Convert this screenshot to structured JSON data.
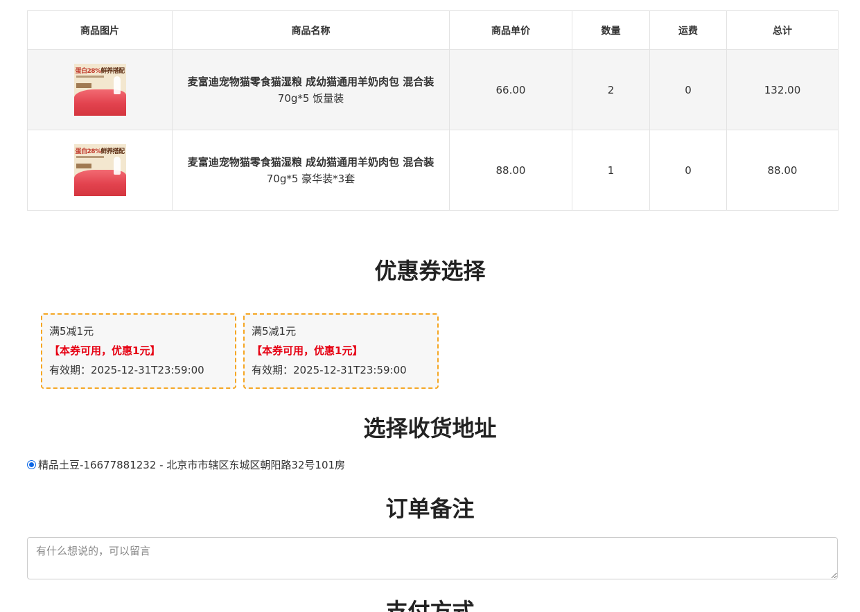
{
  "table": {
    "headers": [
      "商品图片",
      "商品名称",
      "商品单价",
      "数量",
      "运费",
      "总计"
    ],
    "rows": [
      {
        "thumb_text": "蛋白28%",
        "thumb_suffix": "鲜养搭配",
        "name_main": "麦富迪宠物猫零食猫湿粮 成幼猫通用羊奶肉包 混合装",
        "name_spec": "70g*5 饭量装",
        "price": "66.00",
        "qty": "2",
        "shipping": "0",
        "total": "132.00"
      },
      {
        "thumb_text": "蛋白28%",
        "thumb_suffix": "鲜养搭配",
        "name_main": "麦富迪宠物猫零食猫湿粮 成幼猫通用羊奶肉包 混合装",
        "name_spec": "70g*5 豪华装*3套",
        "price": "88.00",
        "qty": "1",
        "shipping": "0",
        "total": "88.00"
      }
    ]
  },
  "coupons": {
    "title": "优惠券选择",
    "items": [
      {
        "name": "满5减1元",
        "status": "【本券可用，优惠1元】",
        "validity": "有效期：2025-12-31T23:59:00"
      },
      {
        "name": "满5减1元",
        "status": "【本券可用，优惠1元】",
        "validity": "有效期：2025-12-31T23:59:00"
      }
    ]
  },
  "address": {
    "title": "选择收货地址",
    "selected_text": "精品土豆-16677881232 - 北京市市辖区东城区朝阳路32号101房"
  },
  "remark": {
    "title": "订单备注",
    "placeholder": "有什么想说的，可以留言"
  },
  "payment": {
    "title": "支付方式"
  },
  "colors": {
    "coupon_border": "#f5a623",
    "coupon_status": "#e60012",
    "radio_accent": "#0a66e6"
  }
}
